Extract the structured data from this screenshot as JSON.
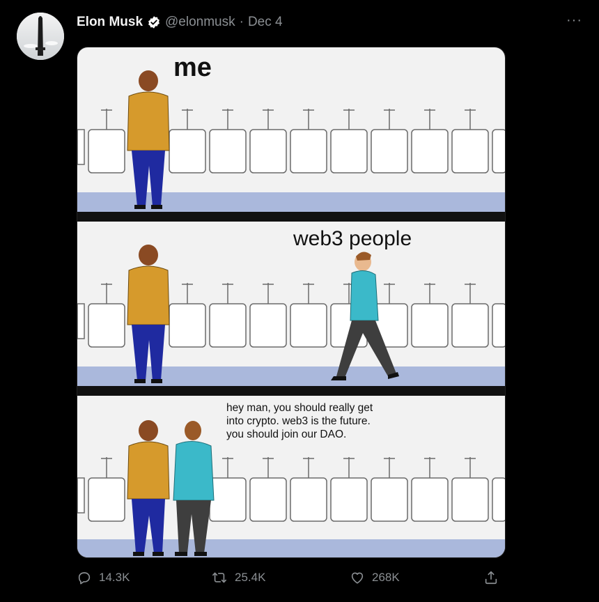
{
  "tweet": {
    "author_name": "Elon Musk",
    "handle": "@elonmusk",
    "separator": "·",
    "date": "Dec 4",
    "more": "···"
  },
  "meme": {
    "panel1_caption": "me",
    "panel2_caption": "web3 people",
    "panel3_caption": "hey man, you should really get into crypto. web3 is the future. you should join our DAO."
  },
  "actions": {
    "replies": "14.3K",
    "retweets": "25.4K",
    "likes": "268K"
  },
  "colors": {
    "background": "#000000",
    "text_primary": "#f3f3f3",
    "text_secondary": "#8b8f93",
    "verified": "#ffffff"
  },
  "icons": [
    "verified-badge-icon",
    "more-icon",
    "reply-icon",
    "retweet-icon",
    "like-icon",
    "share-icon"
  ]
}
